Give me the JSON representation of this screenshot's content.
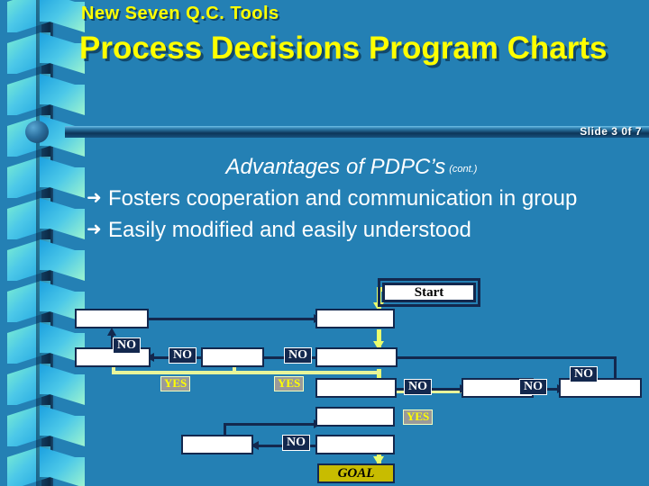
{
  "slide": {
    "kicker": "New Seven Q.C. Tools",
    "title": "Process Decisions Program Charts",
    "counter": "Slide 3 0f 7",
    "subhead": "Advantages of PDPC’s",
    "subhead_note": "(cont.)",
    "bullet_marker": "➜",
    "bullets": [
      "Fosters cooperation and communication in group",
      "Easily modified and easily understood"
    ]
  },
  "colors": {
    "background": "#2480b4",
    "title_text": "#ffff00",
    "body_text": "#ffffff",
    "box_fill": "#ffffff",
    "box_border": "#13284e",
    "goal_fill": "#c8bc00",
    "yes_path": "#eaff6e",
    "no_label_bg": "#13284e",
    "yes_label_bg": "#9a9a9a",
    "ribbon_light": "#9ef5cf",
    "ribbon_mid": "#4cc8e8",
    "ribbon_dark": "#1ba0e0"
  },
  "flowchart": {
    "start_label": "Start",
    "goal_label": "GOAL",
    "no_label": "NO",
    "yes_label": "YES",
    "blank_nodes": 12,
    "no_edges": 7,
    "yes_edges": 3
  }
}
